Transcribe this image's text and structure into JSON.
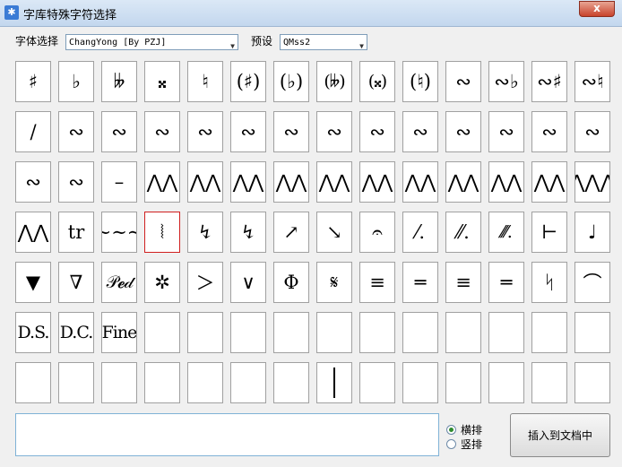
{
  "window": {
    "title": "字库特殊字符选择",
    "close_label": "x"
  },
  "toolbar": {
    "font_label": "字体选择",
    "font_value": "ChangYong [By PZJ]",
    "preset_label": "预设",
    "preset_value": "QMss2"
  },
  "symbols": [
    [
      "♯",
      "♭",
      "𝄫",
      "𝄪",
      "♮",
      "(♯)",
      "(♭)",
      "(𝄫)",
      "(𝄪)",
      "(♮)",
      "∾",
      "∾♭",
      "∾♯",
      "∾♮"
    ],
    [
      "/",
      "∾",
      "∾",
      "∾",
      "∾",
      "∾",
      "∾",
      "∾",
      "∾",
      "∾",
      "∾",
      "∾",
      "∾",
      "∾"
    ],
    [
      "∾",
      "∾",
      "–",
      "⋀⋀",
      "⋀⋀",
      "⋀⋀",
      "⋀⋀",
      "⋀⋀",
      "⋀⋀",
      "⋀⋀",
      "⋀⋀",
      "⋀⋀",
      "⋀⋀",
      "⋀⋀⋀"
    ],
    [
      "⋀⋀",
      "tr",
      "∼∼∼",
      "⦚",
      "↯",
      "↯",
      "↗",
      "↘",
      "𝄐",
      "⁄.",
      "⁄⁄.",
      "⁄⁄⁄.",
      "⊢",
      "♩"
    ],
    [
      "▼",
      "∇",
      "𝒫𝓮𝒹",
      "✲",
      "＞",
      "∨",
      "Φ",
      "𝄋",
      "≡",
      "═",
      "≡",
      "═",
      "ᛋ",
      "⌒"
    ],
    [
      "D.S.",
      "D.C.",
      "Fine",
      "",
      "",
      "",
      "",
      "",
      "",
      "",
      "",
      "",
      "",
      ""
    ],
    [
      "",
      "",
      "",
      "",
      "",
      "",
      "",
      "",
      "",
      "",
      "",
      "",
      "",
      ""
    ]
  ],
  "bottom": {
    "text_value": "",
    "radio_horizontal": "横排",
    "radio_vertical": "竖排",
    "insert_button": "插入到文档中"
  }
}
